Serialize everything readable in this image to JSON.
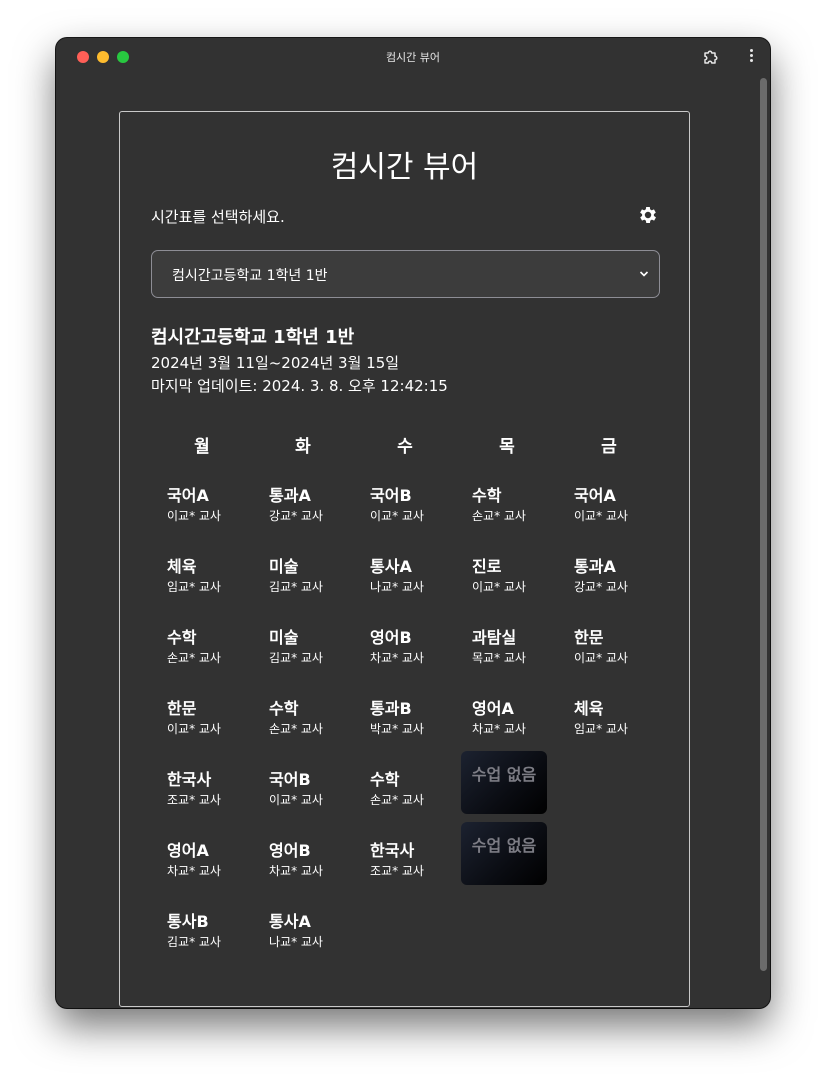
{
  "window": {
    "title": "컴시간 뷰어"
  },
  "toolbar": {
    "extension_icon": "puzzle-icon",
    "menu_icon": "kebab-icon"
  },
  "page": {
    "title": "컴시간 뷰어",
    "prompt": "시간표를 선택하세요.",
    "settings_icon": "gear-icon",
    "selected_class": "컴시간고등학교 1학년 1반",
    "info": {
      "school": "컴시간고등학교 1학년 1반",
      "dates": "2024년 3월 11일~2024년 3월 15일",
      "updated": "마지막 업데이트: 2024. 3. 8. 오후 12:42:15"
    }
  },
  "timetable": {
    "days": [
      "월",
      "화",
      "수",
      "목",
      "금"
    ],
    "columns": [
      [
        {
          "subject": "국어A",
          "teacher": "이교* 교사"
        },
        {
          "subject": "체육",
          "teacher": "임교* 교사"
        },
        {
          "subject": "수학",
          "teacher": "손교* 교사"
        },
        {
          "subject": "한문",
          "teacher": "이교* 교사"
        },
        {
          "subject": "한국사",
          "teacher": "조교* 교사"
        },
        {
          "subject": "영어A",
          "teacher": "차교* 교사"
        },
        {
          "subject": "통사B",
          "teacher": "김교* 교사"
        }
      ],
      [
        {
          "subject": "통과A",
          "teacher": "강교* 교사"
        },
        {
          "subject": "미술",
          "teacher": "김교* 교사"
        },
        {
          "subject": "미술",
          "teacher": "김교* 교사"
        },
        {
          "subject": "수학",
          "teacher": "손교* 교사"
        },
        {
          "subject": "국어B",
          "teacher": "이교* 교사"
        },
        {
          "subject": "영어B",
          "teacher": "차교* 교사"
        },
        {
          "subject": "통사A",
          "teacher": "나교* 교사"
        }
      ],
      [
        {
          "subject": "국어B",
          "teacher": "이교* 교사"
        },
        {
          "subject": "통사A",
          "teacher": "나교* 교사"
        },
        {
          "subject": "영어B",
          "teacher": "차교* 교사"
        },
        {
          "subject": "통과B",
          "teacher": "박교* 교사"
        },
        {
          "subject": "수학",
          "teacher": "손교* 교사"
        },
        {
          "subject": "한국사",
          "teacher": "조교* 교사"
        }
      ],
      [
        {
          "subject": "수학",
          "teacher": "손교* 교사"
        },
        {
          "subject": "진로",
          "teacher": "이교* 교사"
        },
        {
          "subject": "과탐실",
          "teacher": "목교* 교사"
        },
        {
          "subject": "영어A",
          "teacher": "차교* 교사"
        }
      ],
      [
        {
          "subject": "국어A",
          "teacher": "이교* 교사"
        },
        {
          "subject": "통과A",
          "teacher": "강교* 교사"
        },
        {
          "subject": "한문",
          "teacher": "이교* 교사"
        },
        {
          "subject": "체육",
          "teacher": "임교* 교사"
        }
      ]
    ],
    "no_class_label": "수업 없음",
    "no_class_slots": [
      {
        "day": "목",
        "period": 5
      },
      {
        "day": "목",
        "period": 6
      }
    ]
  }
}
